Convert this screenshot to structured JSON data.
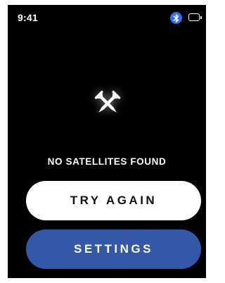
{
  "status_bar": {
    "time": "9:41",
    "bluetooth_icon": "bluetooth-icon",
    "battery_icon": "battery-icon",
    "bluetooth_color": "#2f6ff2"
  },
  "main": {
    "icon": "crossed-nails-icon",
    "message": "NO SATELLITES FOUND"
  },
  "buttons": {
    "try_again_label": "TRY AGAIN",
    "settings_label": "SETTINGS"
  },
  "colors": {
    "background": "#000000",
    "primary_button": "#ffffff",
    "secondary_button": "#3358a8"
  }
}
